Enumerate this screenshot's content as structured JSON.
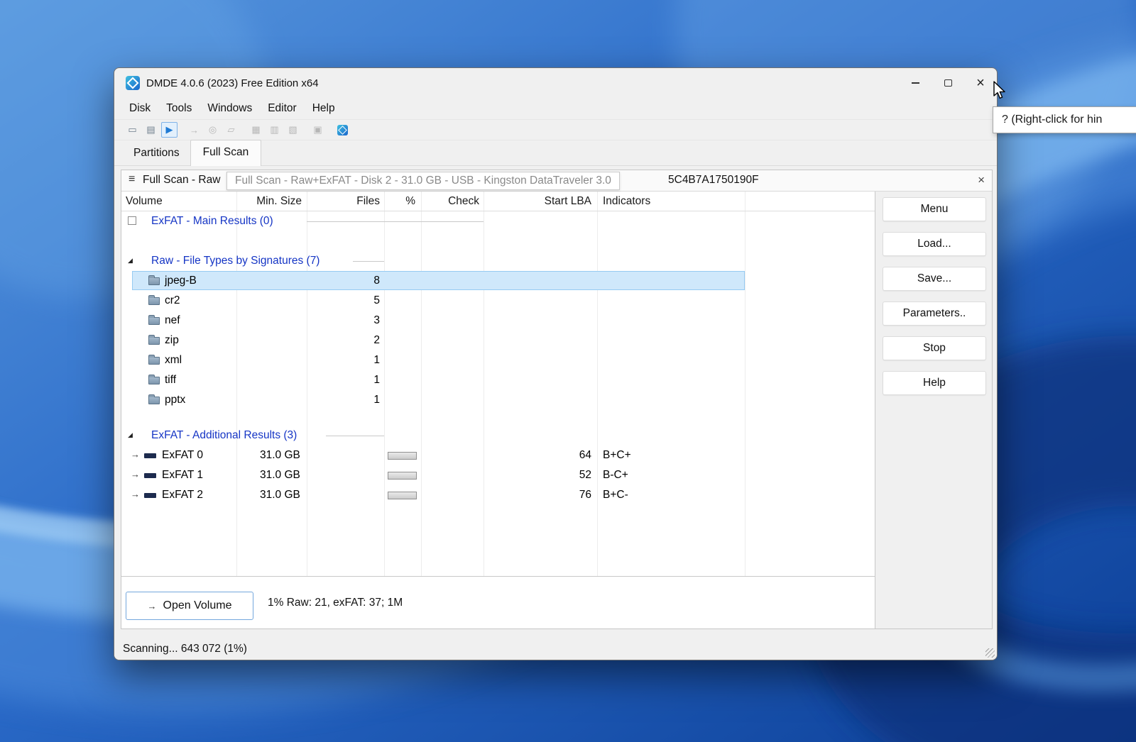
{
  "desktop": {
    "hint_tooltip": "? (Right-click for hin"
  },
  "window": {
    "title": "DMDE 4.0.6 (2023) Free Edition x64",
    "controls": {
      "close_icon": "×"
    },
    "menu": [
      "Disk",
      "Tools",
      "Windows",
      "Editor",
      "Help"
    ],
    "tabs": {
      "partitions": "Partitions",
      "full_scan": "Full Scan"
    }
  },
  "toolbar": {
    "icons": [
      {
        "name": "new-volume-icon",
        "glyph": "▭"
      },
      {
        "name": "device-list-icon",
        "glyph": "▤"
      },
      {
        "name": "continue-scan-icon",
        "glyph": "▶"
      },
      {
        "name": "goto-sector-icon",
        "glyph": "→"
      },
      {
        "name": "search-icon",
        "glyph": "◎"
      },
      {
        "name": "copy-sectors-icon",
        "glyph": "▱"
      },
      {
        "name": "cluster-map-icon",
        "glyph": "▦"
      },
      {
        "name": "sector-view-icon",
        "glyph": "▥"
      },
      {
        "name": "hex-editor-icon",
        "glyph": "▧"
      },
      {
        "name": "windows-layout-icon",
        "glyph": "▣"
      }
    ]
  },
  "panel": {
    "menu_icon": "≡",
    "title_visible_left": "Full Scan - Raw",
    "title_visible_right": "5C4B7A1750190F",
    "tooltip": "Full Scan - Raw+ExFAT - Disk 2 - 31.0 GB - USB - Kingston DataTraveler 3.0",
    "close_icon": "×"
  },
  "table": {
    "columns": [
      "Volume",
      "Min. Size",
      "Files",
      "%",
      "Check",
      "Start LBA",
      "Indicators"
    ],
    "sort_icon": "ˇ",
    "expander_icon": "◢",
    "row_arrow_icon": "→",
    "sections": {
      "main": "ExFAT - Main Results (0)",
      "raw": "Raw - File Types by Signatures (7)",
      "additional": "ExFAT - Additional Results (3)"
    },
    "file_rows": [
      {
        "name": "jpeg-B",
        "files": "8"
      },
      {
        "name": "cr2",
        "files": "5"
      },
      {
        "name": "nef",
        "files": "3"
      },
      {
        "name": "zip",
        "files": "2"
      },
      {
        "name": "xml",
        "files": "1"
      },
      {
        "name": "tiff",
        "files": "1"
      },
      {
        "name": "pptx",
        "files": "1"
      }
    ],
    "exfat_rows": [
      {
        "name": "ExFAT 0",
        "min_size": "31.0 GB",
        "start_lba": "64",
        "indicators": "B+C+"
      },
      {
        "name": "ExFAT 1",
        "min_size": "31.0 GB",
        "start_lba": "52",
        "indicators": "B-C+"
      },
      {
        "name": "ExFAT 2",
        "min_size": "31.0 GB",
        "start_lba": "76",
        "indicators": "B+C-"
      }
    ]
  },
  "side_buttons": [
    "Menu",
    "Load...",
    "Save...",
    "Parameters..",
    "Stop",
    "Help"
  ],
  "bottom": {
    "open_volume": "Open Volume",
    "open_volume_icon": "→",
    "progress": "1% Raw: 21, exFAT: 37; 1M"
  },
  "statusbar": {
    "text": "Scanning... 643 072 (1%)"
  }
}
